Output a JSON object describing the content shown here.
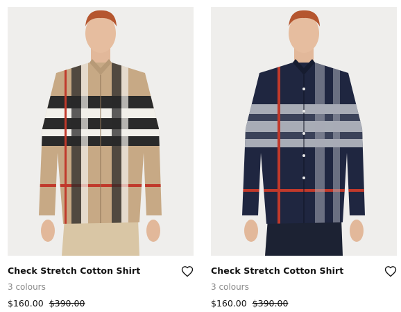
{
  "products": [
    {
      "title": "Check Stretch Cotton Shirt",
      "colours": "3 colours",
      "price": "$160.00",
      "original_price": "$390.00",
      "wishlist_icon": "heart-outline-icon",
      "shirt_colour": "#c7a985"
    },
    {
      "title": "Check Stretch Cotton Shirt",
      "colours": "3 colours",
      "price": "$160.00",
      "original_price": "$390.00",
      "wishlist_icon": "heart-outline-icon",
      "shirt_colour": "#1f2640"
    }
  ]
}
